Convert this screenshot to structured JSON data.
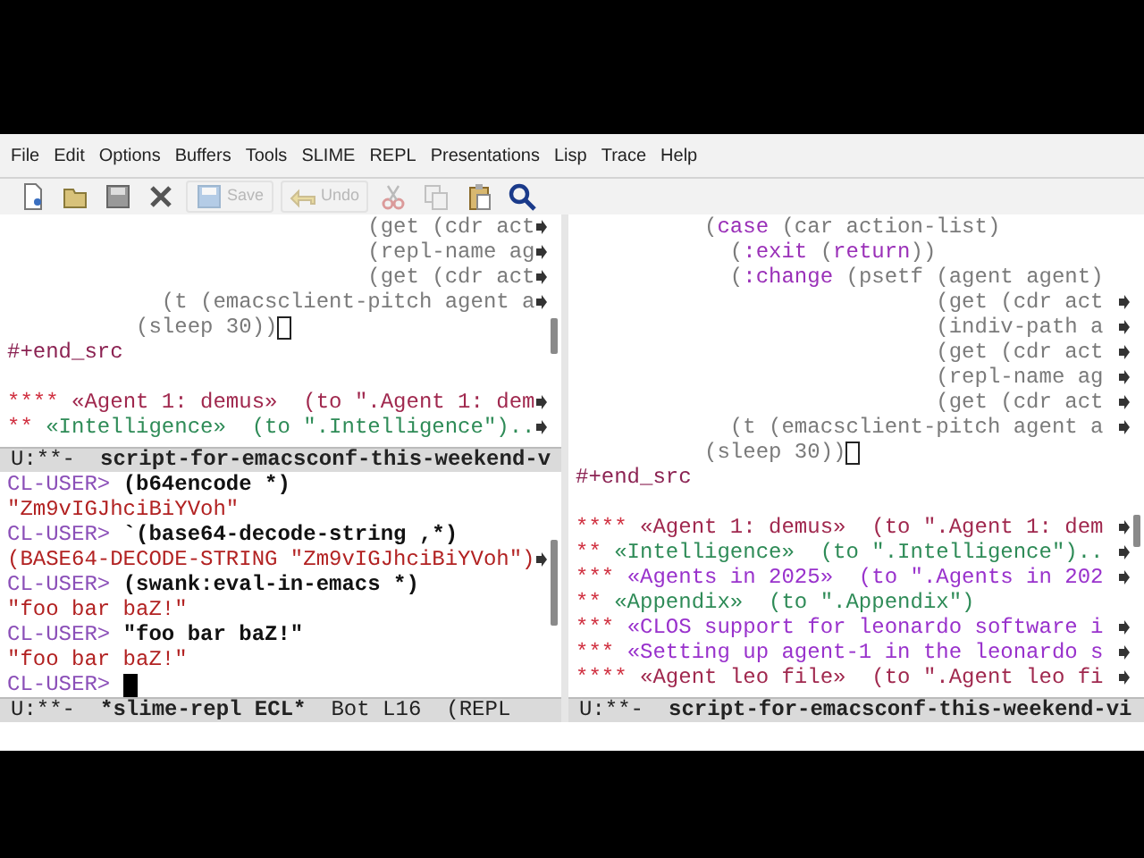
{
  "menu": [
    {
      "label": "File"
    },
    {
      "label": "Edit"
    },
    {
      "label": "Options"
    },
    {
      "label": "Buffers"
    },
    {
      "label": "Tools"
    },
    {
      "label": "SLIME"
    },
    {
      "label": "REPL"
    },
    {
      "label": "Presentations"
    },
    {
      "label": "Lisp"
    },
    {
      "label": "Trace"
    },
    {
      "label": "Help"
    }
  ],
  "toolbar": [
    {
      "disabled": false
    },
    {
      "disabled": false
    },
    {
      "disabled": false
    },
    {
      "disabled": false
    },
    {
      "label": "Save",
      "disabled": true
    },
    {
      "label": "Undo",
      "disabled": true
    },
    {
      "disabled": true
    },
    {
      "disabled": true
    },
    {
      "disabled": false
    },
    {
      "disabled": false
    }
  ],
  "panes": [
    {
      "lines": [
        {
          "segments": [
            {
              "kind": "code",
              "text": "                            (get (cdr act"
            }
          ],
          "truncated": true
        },
        {
          "segments": [
            {
              "kind": "code",
              "text": "                            (repl-name ag"
            }
          ],
          "truncated": true
        },
        {
          "segments": [
            {
              "kind": "code",
              "text": "                            (get (cdr act"
            }
          ],
          "truncated": true
        },
        {
          "segments": [
            {
              "kind": "code",
              "text": "            (t (emacsclient-pitch agent a"
            }
          ],
          "truncated": true
        },
        {
          "segments": [
            {
              "kind": "code",
              "text": "          (sleep 30))"
            }
          ],
          "cursor": true,
          "solid": false
        },
        {
          "segments": [
            {
              "kind": "meta",
              "text": "#+end_src"
            }
          ]
        },
        {
          "blank": true
        },
        {
          "segments": [
            {
              "kind": "stars",
              "text": "****"
            },
            {
              "kind": "h4",
              "text": " «Agent 1: demus»  (to \".Agent 1: dem"
            }
          ],
          "truncated": true
        },
        {
          "segments": [
            {
              "kind": "stars",
              "text": "**"
            },
            {
              "kind": "h2",
              "text": " «Intelligence»  (to \".Intelligence\").."
            }
          ],
          "truncated": true
        }
      ],
      "modeline": [
        {
          "kind": "status",
          "text": "U:**-"
        },
        {
          "kind": "buffer",
          "text": "script-for-emacsconf-this-weekend-v"
        }
      ]
    },
    {
      "lines": [
        {
          "segments": [
            {
              "kind": "prompt",
              "text": "CL-USER>"
            },
            {
              "kind": "input",
              "text": " (b64encode *)"
            }
          ]
        },
        {
          "segments": [
            {
              "kind": "output",
              "text": "\"Zm9vIGJhciBiYVoh\""
            }
          ]
        },
        {
          "segments": [
            {
              "kind": "prompt",
              "text": "CL-USER>"
            },
            {
              "kind": "input",
              "text": " `(base64-decode-string ,*)"
            }
          ]
        },
        {
          "segments": [
            {
              "kind": "output",
              "text": "(BASE64-DECODE-STRING \"Zm9vIGJhciBiYVoh\")"
            }
          ],
          "truncated": true
        },
        {
          "segments": [
            {
              "kind": "prompt",
              "text": "CL-USER>"
            },
            {
              "kind": "input",
              "text": " (swank:eval-in-emacs *)"
            }
          ]
        },
        {
          "segments": [
            {
              "kind": "output",
              "text": "\"foo bar baZ!\""
            }
          ]
        },
        {
          "segments": [
            {
              "kind": "prompt",
              "text": "CL-USER>"
            },
            {
              "kind": "input",
              "text": " \"foo bar baZ!\""
            }
          ]
        },
        {
          "segments": [
            {
              "kind": "output",
              "text": "\"foo bar baZ!\""
            }
          ]
        },
        {
          "segments": [
            {
              "kind": "prompt",
              "text": "CL-USER>"
            }
          ],
          "cursor": true,
          "solid": true
        }
      ],
      "modeline": [
        {
          "kind": "status",
          "text": "U:**-"
        },
        {
          "kind": "buffer",
          "text": "*slime-repl ECL*"
        },
        {
          "kind": "position",
          "text": "Bot L16"
        },
        {
          "kind": "mode",
          "text": "(REPL"
        }
      ]
    },
    {
      "lines": [
        {
          "segments": [
            {
              "kind": "code",
              "text": "          ("
            },
            {
              "kind": "keyword",
              "text": "case"
            },
            {
              "kind": "code",
              "text": " (car action-list)"
            }
          ]
        },
        {
          "segments": [
            {
              "kind": "code",
              "text": "            ("
            },
            {
              "kind": "keyword",
              "text": ":exit"
            },
            {
              "kind": "code",
              "text": " ("
            },
            {
              "kind": "keyword",
              "text": "return"
            },
            {
              "kind": "code",
              "text": "))"
            }
          ]
        },
        {
          "segments": [
            {
              "kind": "code",
              "text": "            ("
            },
            {
              "kind": "keyword",
              "text": ":change"
            },
            {
              "kind": "code",
              "text": " (psetf (agent agent)"
            }
          ]
        },
        {
          "segments": [
            {
              "kind": "code",
              "text": "                            (get (cdr act"
            }
          ],
          "truncated": true
        },
        {
          "segments": [
            {
              "kind": "code",
              "text": "                            (indiv-path a"
            }
          ],
          "truncated": true
        },
        {
          "segments": [
            {
              "kind": "code",
              "text": "                            (get (cdr act"
            }
          ],
          "truncated": true
        },
        {
          "segments": [
            {
              "kind": "code",
              "text": "                            (repl-name ag"
            }
          ],
          "truncated": true
        },
        {
          "segments": [
            {
              "kind": "code",
              "text": "                            (get (cdr act"
            }
          ],
          "truncated": true
        },
        {
          "segments": [
            {
              "kind": "code",
              "text": "            (t (emacsclient-pitch agent a"
            }
          ],
          "truncated": true
        },
        {
          "segments": [
            {
              "kind": "code",
              "text": "          (sleep 30))"
            }
          ],
          "cursor": true,
          "solid": false
        },
        {
          "segments": [
            {
              "kind": "meta",
              "text": "#+end_src"
            }
          ]
        },
        {
          "blank": true
        },
        {
          "segments": [
            {
              "kind": "stars",
              "text": "****"
            },
            {
              "kind": "h4",
              "text": " «Agent 1: demus»  (to \".Agent 1: dem"
            }
          ],
          "truncated": true
        },
        {
          "segments": [
            {
              "kind": "stars",
              "text": "**"
            },
            {
              "kind": "h2",
              "text": " «Intelligence»  (to \".Intelligence\").."
            }
          ],
          "truncated": true
        },
        {
          "segments": [
            {
              "kind": "stars",
              "text": "***"
            },
            {
              "kind": "h3",
              "text": " «Agents in 2025»  (to \".Agents in 202"
            }
          ],
          "truncated": true
        },
        {
          "segments": [
            {
              "kind": "stars",
              "text": "**"
            },
            {
              "kind": "h2",
              "text": " «Appendix»  (to \".Appendix\")"
            }
          ]
        },
        {
          "segments": [
            {
              "kind": "stars",
              "text": "***"
            },
            {
              "kind": "h3",
              "text": " «CLOS support for leonardo software i"
            }
          ],
          "truncated": true
        },
        {
          "segments": [
            {
              "kind": "stars",
              "text": "***"
            },
            {
              "kind": "h3",
              "text": " «Setting up agent-1 in the leonardo s"
            }
          ],
          "truncated": true
        },
        {
          "segments": [
            {
              "kind": "stars",
              "text": "****"
            },
            {
              "kind": "h4",
              "text": " «Agent leo file»  (to \".Agent leo fi"
            }
          ],
          "truncated": true
        }
      ],
      "modeline": [
        {
          "kind": "status",
          "text": "U:**-"
        },
        {
          "kind": "buffer",
          "text": "script-for-emacsconf-this-weekend-vi"
        }
      ]
    }
  ]
}
